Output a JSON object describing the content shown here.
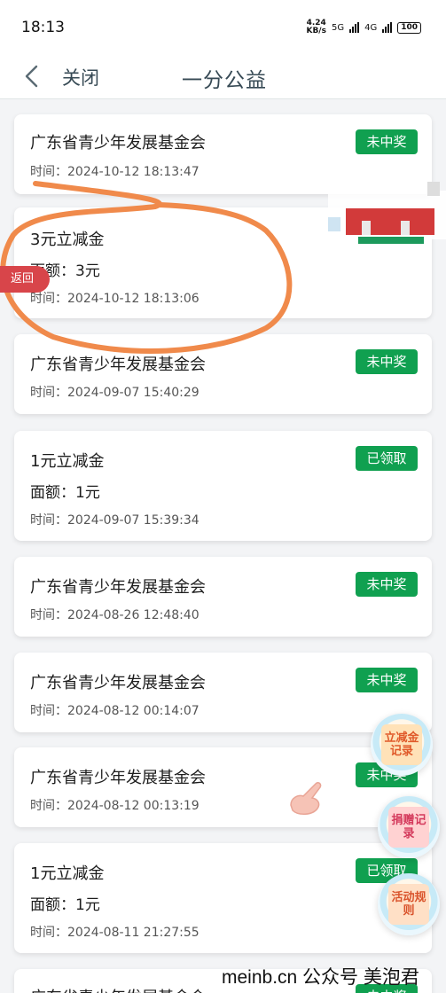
{
  "status_bar": {
    "time": "18:13",
    "speed": "4.24\nKB/s",
    "network_1": "5G",
    "network_2": "4G",
    "battery": "100"
  },
  "nav": {
    "close_label": "关闭",
    "title": "一分公益"
  },
  "records": [
    {
      "title": "广东省青少年发展基金会",
      "amount": "",
      "time": "时间：2024-10-12 18:13:47",
      "status": "未中奖"
    },
    {
      "title": "3元立减金",
      "amount": "面额：3元",
      "time": "时间：2024-10-12 18:13:06",
      "status": ""
    },
    {
      "title": "广东省青少年发展基金会",
      "amount": "",
      "time": "时间：2024-09-07 15:40:29",
      "status": "未中奖"
    },
    {
      "title": "1元立减金",
      "amount": "面额：1元",
      "time": "时间：2024-09-07 15:39:34",
      "status": "已领取"
    },
    {
      "title": "广东省青少年发展基金会",
      "amount": "",
      "time": "时间：2024-08-26 12:48:40",
      "status": "未中奖"
    },
    {
      "title": "广东省青少年发展基金会",
      "amount": "",
      "time": "时间：2024-08-12 00:14:07",
      "status": "未中奖"
    },
    {
      "title": "广东省青少年发展基金会",
      "amount": "",
      "time": "时间：2024-08-12 00:13:19",
      "status": "未中奖"
    },
    {
      "title": "1元立减金",
      "amount": "面额：1元",
      "time": "时间：2024-08-11 21:27:55",
      "status": "已领取"
    },
    {
      "title": "广东省青少年发展基金会",
      "amount": "",
      "time": "",
      "status": "未中奖"
    }
  ],
  "return_tab": "返回",
  "floating": {
    "coupon_records": "立减金记录",
    "donation_records": "捐赠记录",
    "activity_rules": "活动规则"
  },
  "watermark": "meinb.cn  公众号 美泡君",
  "colors": {
    "badge_green": "#10a050",
    "return_red": "#d8454a",
    "annotation_orange": "#f08a4b"
  }
}
